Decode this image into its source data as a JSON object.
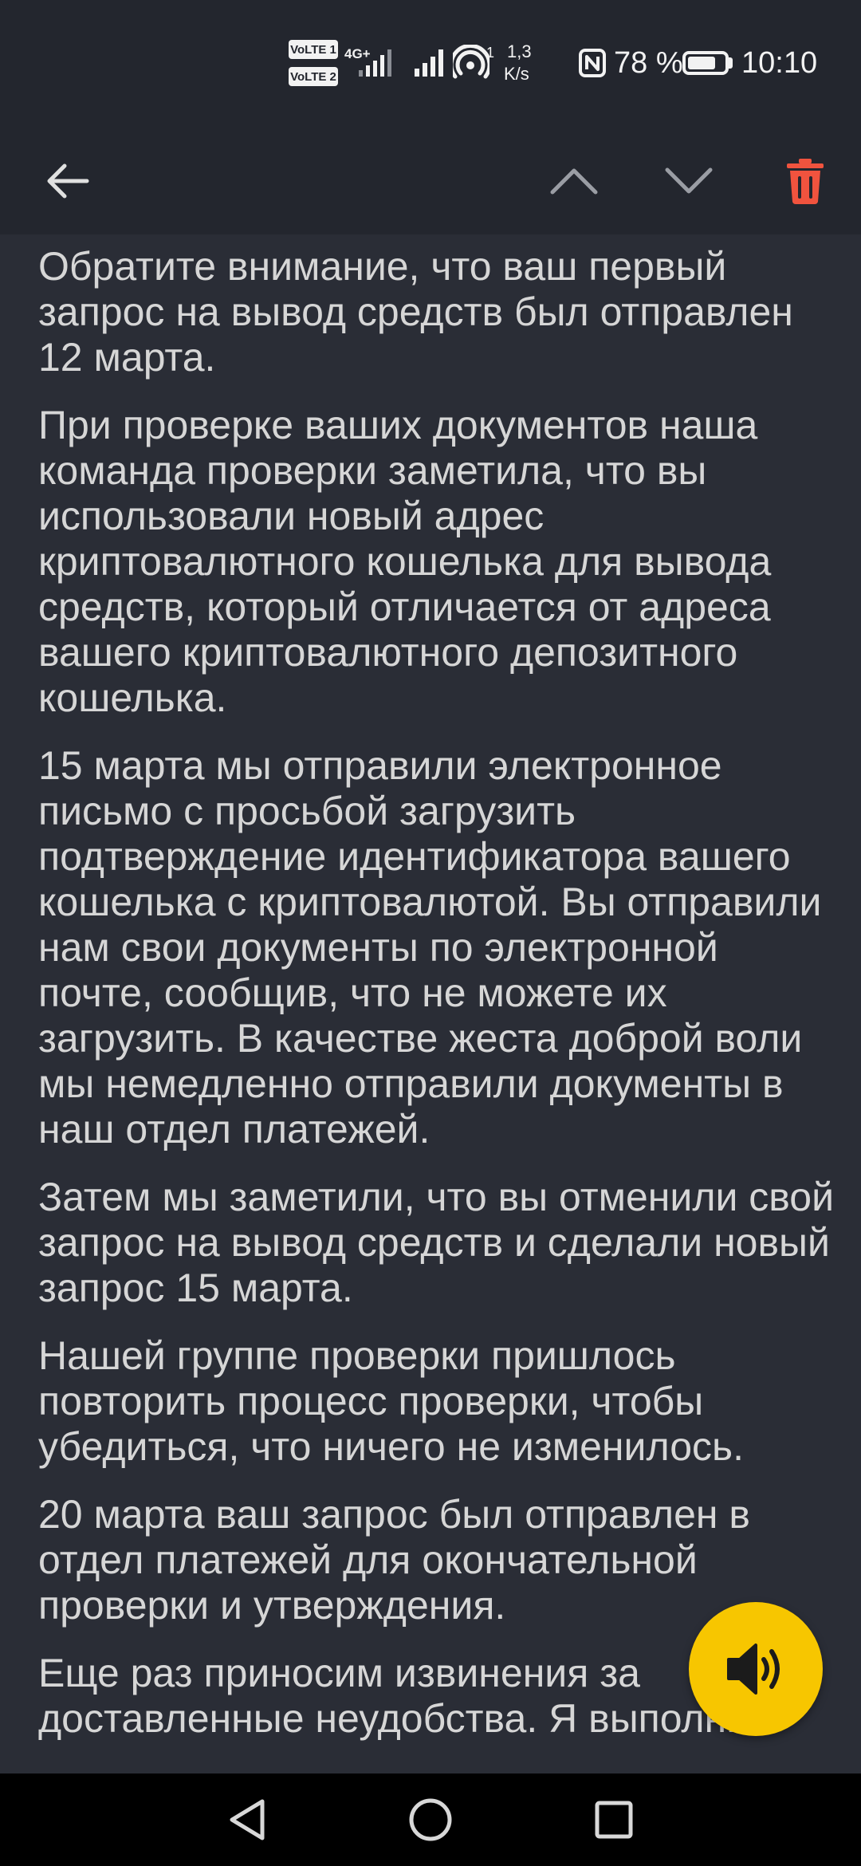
{
  "status_bar": {
    "volte1": "VoLTE 1",
    "volte2": "VoLTE 2",
    "network_type": "4G+",
    "hotspot_count": "1",
    "speed_value": "1,3",
    "speed_unit": "K/s",
    "battery_text": "78 %",
    "battery_level": 0.78,
    "time": "10:10"
  },
  "toolbar": {
    "back_icon": "arrow-left",
    "prev_icon": "chevron-up",
    "next_icon": "chevron-down",
    "delete_icon": "trash",
    "delete_color": "#f0533e"
  },
  "message": {
    "paragraphs": [
      "Обратите внимание, что ваш первый запрос на вывод средств был отправлен 12 марта.",
      "При проверке ваших документов наша команда проверки заметила, что вы использовали новый адрес криптовалютного кошелька для вывода средств, который отличается от адреса вашего криптовалютного депозитного кошелька.",
      "15 марта мы отправили электронное письмо с просьбой загрузить подтверждение идентификатора вашего кошелька с криптовалютой. Вы отправили нам свои документы по электронной почте, сообщив, что не можете их загрузить. В качестве жеста доброй воли мы немедленно отправили документы в наш отдел платежей.",
      "Затем мы заметили, что вы отменили свой запрос на вывод средств и сделали новый запрос 15 марта.",
      "Нашей группе проверки пришлось повторить процесс проверки, чтобы убедиться, что ничего не изменилось.",
      "20 марта ваш запрос был отправлен в отдел платежей для окончательной проверки и утверждения.",
      "Еще раз приносим извинения за доставленные неудобства. Я выполню"
    ]
  },
  "fab": {
    "icon": "speaker-icon",
    "color": "#f7c600"
  },
  "nav_bar": {
    "back_icon": "triangle-back",
    "home_icon": "circle-home",
    "recents_icon": "square-recents"
  }
}
